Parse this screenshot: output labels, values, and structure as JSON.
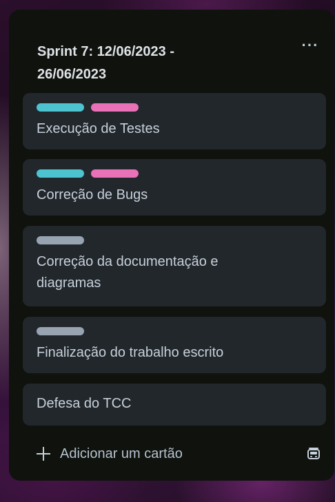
{
  "list": {
    "title": "Sprint 7: 12/06/2023 -\n26/06/2023",
    "more_icon": "more-dots-icon",
    "more_label": "···",
    "cards": [
      {
        "title": "Execução de Testes",
        "labels": [
          {
            "color": "#4cc3cf"
          },
          {
            "color": "#e871b8"
          }
        ]
      },
      {
        "title": "Correção de Bugs",
        "labels": [
          {
            "color": "#4cc3cf"
          },
          {
            "color": "#e871b8"
          }
        ]
      },
      {
        "title": "Correção da documentação e\ndiagramas",
        "labels": [
          {
            "color": "#98a3b2"
          }
        ]
      },
      {
        "title": "Finalização do trabalho escrito",
        "labels": [
          {
            "color": "#98a3b2"
          }
        ]
      },
      {
        "title": "Defesa do TCC",
        "labels": []
      }
    ],
    "add_card_label": "Adicionar um cartão",
    "add_card_icon": "plus-icon",
    "template_icon": "card-template-icon"
  }
}
